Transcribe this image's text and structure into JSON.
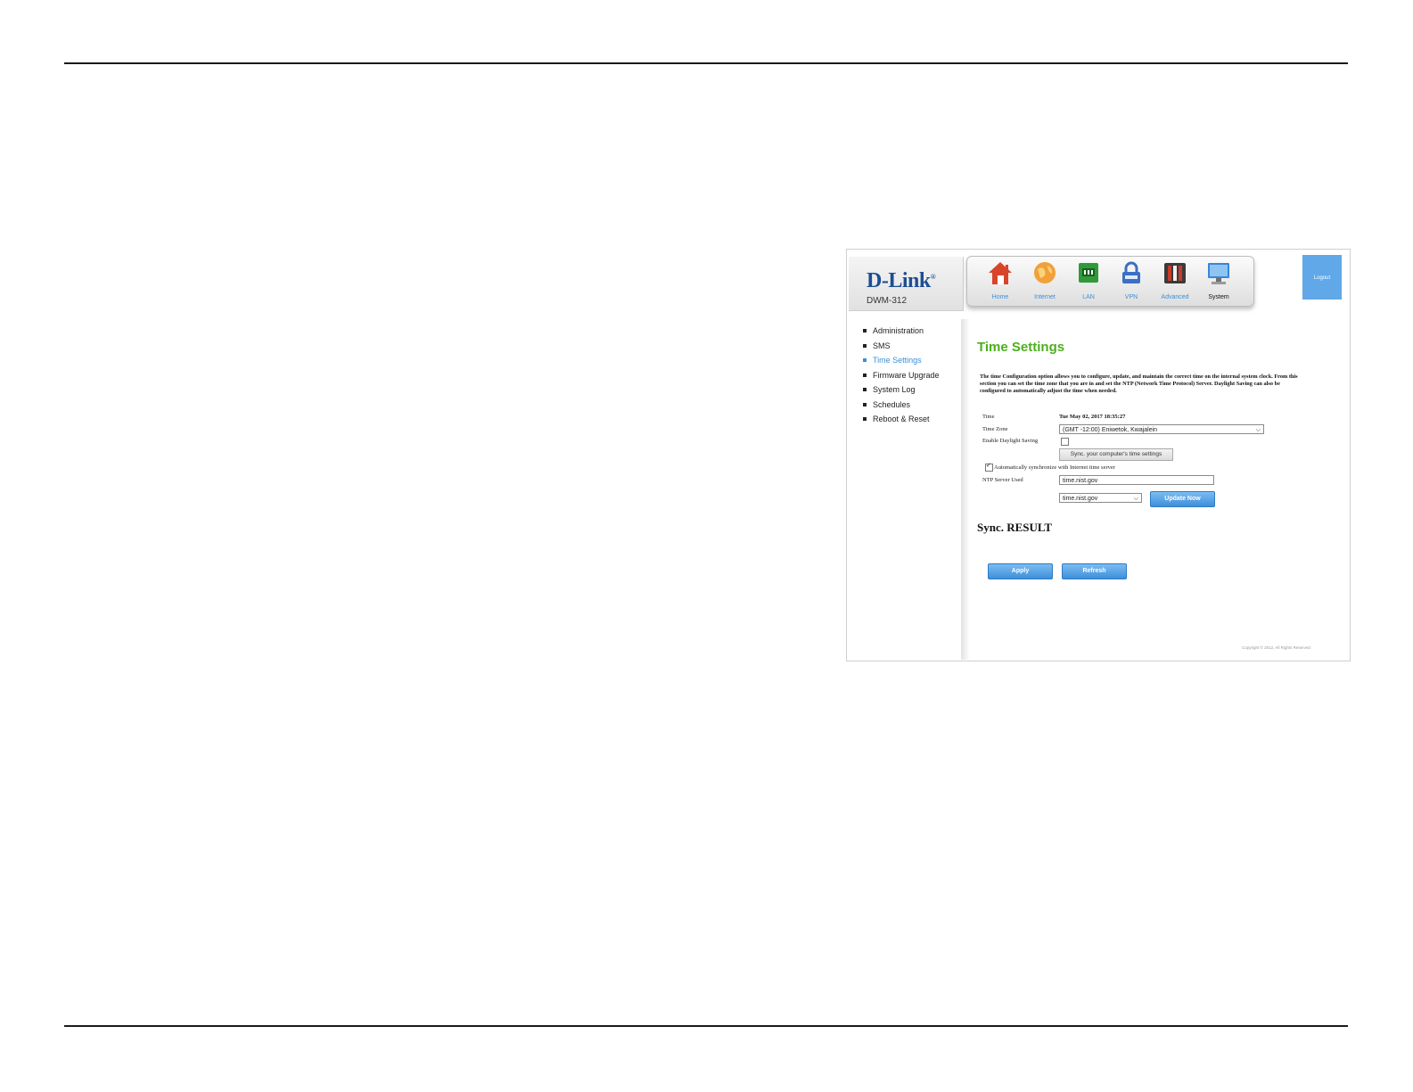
{
  "brand": {
    "logo": "D-Link",
    "model": "DWM-312"
  },
  "nav": [
    {
      "label": "Home",
      "icon": "home-icon",
      "color": "#d8452a"
    },
    {
      "label": "Internet",
      "icon": "globe-icon",
      "color": "#f2a03a"
    },
    {
      "label": "LAN",
      "icon": "lan-icon",
      "color": "#2f9b38"
    },
    {
      "label": "VPN",
      "icon": "lock-icon",
      "color": "#3b6fc4"
    },
    {
      "label": "Advanced",
      "icon": "tools-icon",
      "color": "#8a2b23"
    },
    {
      "label": "System",
      "icon": "monitor-icon",
      "color": "#3a86d6"
    }
  ],
  "logout": "Logout",
  "sidebar": [
    {
      "label": "Administration"
    },
    {
      "label": "SMS"
    },
    {
      "label": "Time Settings"
    },
    {
      "label": "Firmware Upgrade"
    },
    {
      "label": "System Log"
    },
    {
      "label": "Schedules"
    },
    {
      "label": "Reboot & Reset"
    }
  ],
  "main": {
    "title": "Time Settings",
    "description": "The time Configuration option allows you to configure, update, and maintain the correct time on the internal system clock. From this section you can set the time zone that you are in and set the NTP (Network Time Protocol) Server. Daylight Saving can also be configured to automatically adjust the time when needed.",
    "time_label": "Time",
    "time_value": "Tue May 02, 2017 18:35:27",
    "tz_label": "Time Zone",
    "tz_value": "(GMT -12:00) Eniwetok, Kwajalein",
    "dst_label": "Enable Daylight Saving",
    "sync_computer_button": "Sync. your computer's time settings",
    "auto_sync_label": "Automatically synchronize with Internet time server",
    "ntp_label": "NTP Server Used",
    "ntp_input": "time.nist.gov",
    "ntp_select": "time.nist.gov",
    "update_button": "Update Now",
    "sync_result": "Sync. RESULT",
    "apply_button": "Apply",
    "refresh_button": "Refresh",
    "copyright": "Copyright © 2012, All Rights Reserved"
  },
  "colors": {
    "title_green": "#4caf1e",
    "link_blue": "#3a8fd8",
    "brand_blue": "#1e4d93"
  }
}
